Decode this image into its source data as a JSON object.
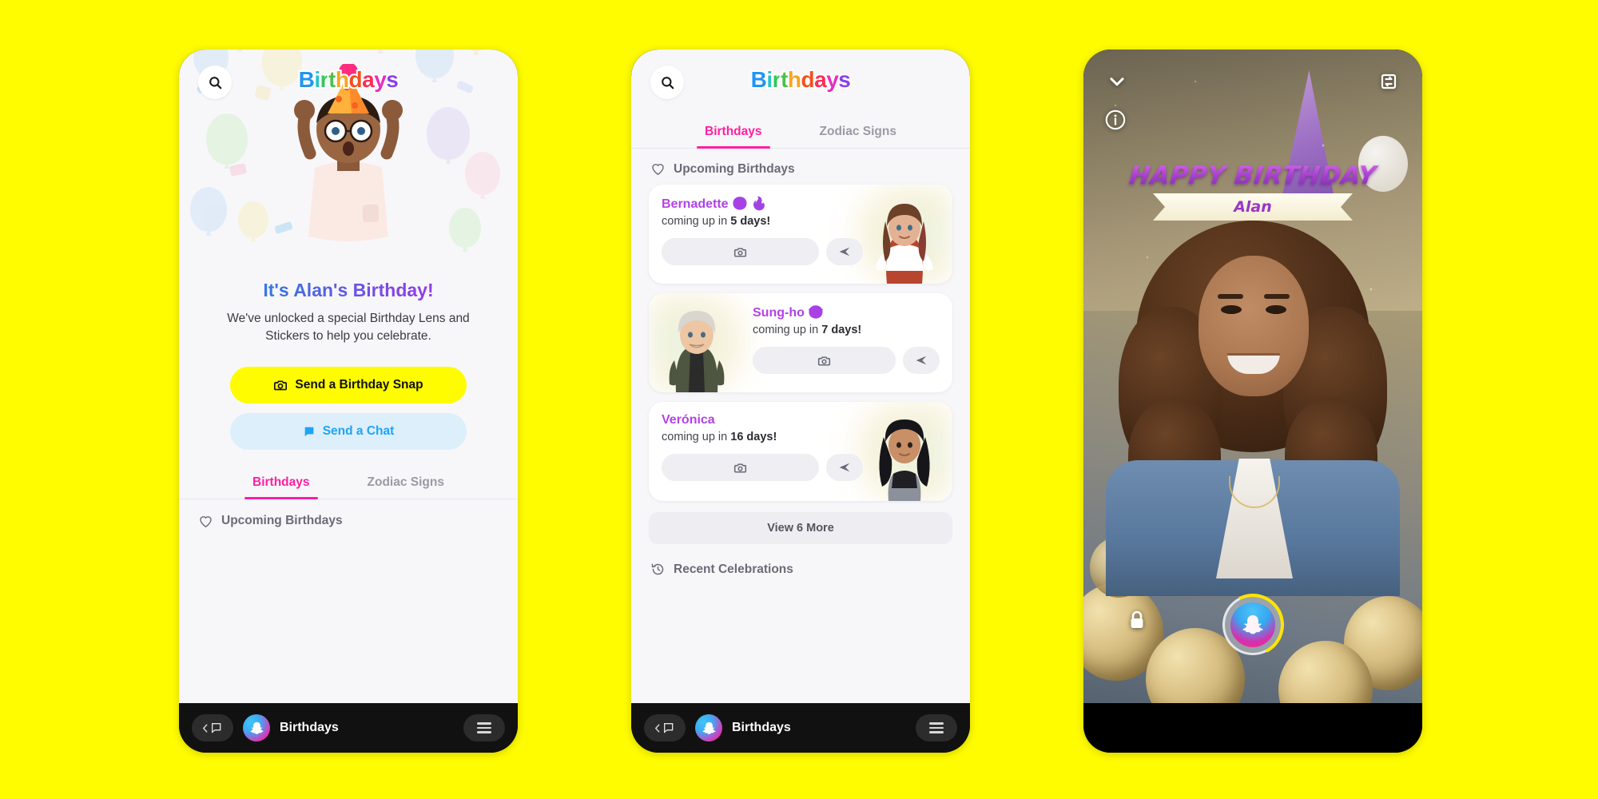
{
  "page": {
    "background_color": "#FFFC00"
  },
  "brand": {
    "title": "Birthdays",
    "letters": [
      {
        "char": "B",
        "color": "#2196F3"
      },
      {
        "char": "i",
        "color": "#2BC4C4"
      },
      {
        "char": "r",
        "color": "#34C759"
      },
      {
        "char": "t",
        "color": "#4CC14A"
      },
      {
        "char": "h",
        "color": "#F5A623"
      },
      {
        "char": "d",
        "color": "#F5501E"
      },
      {
        "char": "a",
        "color": "#FF2D55"
      },
      {
        "char": "y",
        "color": "#E62EC0"
      },
      {
        "char": "s",
        "color": "#8B3FE8"
      }
    ]
  },
  "phone1": {
    "header": {
      "search_icon": "search-icon"
    },
    "hero": {
      "title": "It's Alan's Birthday!",
      "subtitle": "We've unlocked a special Birthday Lens and Stickers to help you celebrate."
    },
    "buttons": {
      "primary": {
        "label": "Send a Birthday Snap",
        "icon": "camera-icon",
        "color": "#FFFC00"
      },
      "secondary": {
        "label": "Send a Chat",
        "icon": "chat-icon",
        "color": "#DDEFFB",
        "text_color": "#1FA3F5"
      }
    },
    "tabs": [
      {
        "label": "Birthdays",
        "active": true
      },
      {
        "label": "Zodiac Signs",
        "active": false
      }
    ],
    "section": {
      "label": "Upcoming Birthdays",
      "icon": "heart-icon"
    },
    "bottom_bar": {
      "back_icon": "chat-back-icon",
      "logo_icon": "snapchat-ghost-icon",
      "title": "Birthdays",
      "menu_icon": "hamburger-menu-icon"
    }
  },
  "phone2": {
    "header": {
      "search_icon": "search-icon"
    },
    "tabs": [
      {
        "label": "Birthdays",
        "active": true
      },
      {
        "label": "Zodiac Signs",
        "active": false
      }
    ],
    "section": {
      "label": "Upcoming Birthdays",
      "icon": "heart-icon"
    },
    "cards": [
      {
        "name": "Bernadette 😊 🔥",
        "when_prefix": "coming up in ",
        "when_value": "5 days!",
        "avatar_side": "right",
        "camera_icon": "camera-icon",
        "send_icon": "send-arrow-icon"
      },
      {
        "name": "Sung-ho 😎",
        "when_prefix": "coming up in ",
        "when_value": "7 days!",
        "avatar_side": "left",
        "camera_icon": "camera-icon",
        "send_icon": "send-arrow-icon"
      },
      {
        "name": "Verónica",
        "when_prefix": "coming up in ",
        "when_value": "16 days!",
        "avatar_side": "right",
        "camera_icon": "camera-icon",
        "send_icon": "send-arrow-icon"
      }
    ],
    "view_more": "View 6 More",
    "recent": {
      "label": "Recent Celebrations",
      "icon": "history-clock-icon"
    },
    "bottom_bar": {
      "back_icon": "chat-back-icon",
      "logo_icon": "snapchat-ghost-icon",
      "title": "Birthdays",
      "menu_icon": "hamburger-menu-icon"
    }
  },
  "phone3": {
    "top_left_icon": "chevron-down-icon",
    "info_icon": "info-icon",
    "flip_camera_icon": "flip-camera-icon",
    "sticker": {
      "headline": "HAPPY BIRTHDAY",
      "name": "Alan"
    },
    "lock_icon": "lock-icon",
    "lens_button_icon": "snapchat-ghost-icon",
    "lens_progress_color": "#FFE400"
  }
}
